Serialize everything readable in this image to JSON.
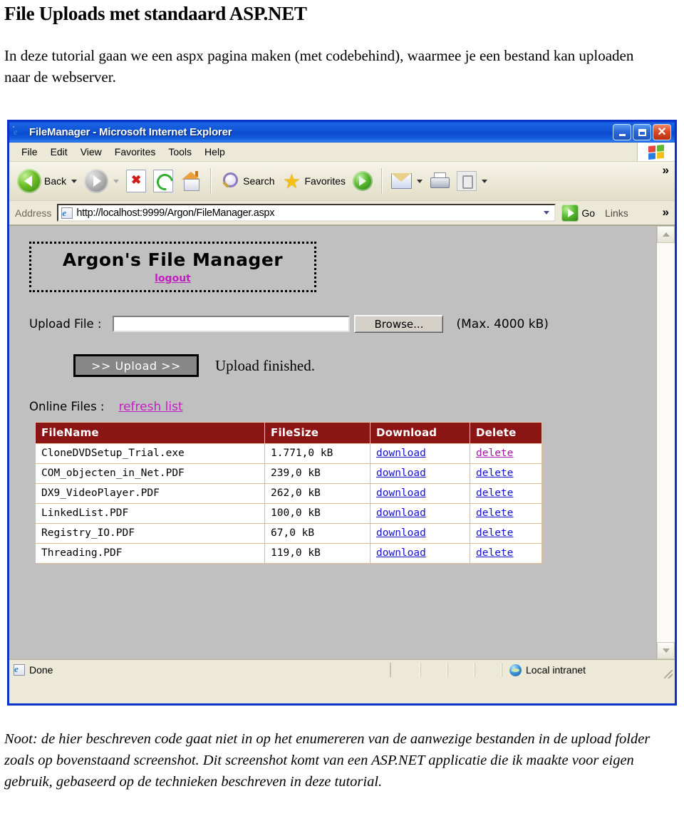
{
  "document": {
    "title": "File Uploads met standaard ASP.NET",
    "intro": "In deze tutorial gaan we een aspx pagina maken (met codebehind), waarmee je een bestand kan uploaden naar de webserver.",
    "note": "Noot: de hier beschreven code gaat niet in op het enumereren van de aanwezige bestanden in de upload folder zoals op bovenstaand screenshot. Dit screenshot komt van een ASP.NET applicatie die ik maakte voor eigen gebruik, gebaseerd op de technieken beschreven in deze tutorial."
  },
  "browser": {
    "title": "FileManager - Microsoft Internet Explorer",
    "window_buttons": {
      "minimize": "minimize",
      "maximize": "restore",
      "close": "close"
    },
    "menu": [
      "File",
      "Edit",
      "View",
      "Favorites",
      "Tools",
      "Help"
    ],
    "menu_overflow": "»",
    "toolbar": {
      "back": "Back",
      "forward": "",
      "stop": "",
      "refresh": "",
      "home": "",
      "search": "Search",
      "favorites": "Favorites",
      "media": "",
      "mail": "",
      "print": "",
      "edit": "",
      "overflow": "»"
    },
    "address": {
      "label": "Address",
      "url": "http://localhost:9999/Argon/FileManager.aspx",
      "go_label": "Go",
      "links_label": "Links",
      "overflow": "»"
    },
    "status": {
      "text": "Done",
      "zone": "Local intranet"
    }
  },
  "app": {
    "title": "Argon's File Manager",
    "logout_label": "logout",
    "upload": {
      "label": "Upload File :",
      "field_value": "",
      "browse_label": "Browse...",
      "max_note": "(Max. 4000 kB)",
      "submit_label": ">> Upload >>",
      "status": "Upload finished."
    },
    "files": {
      "label": "Online Files :",
      "refresh_label": "refresh list",
      "columns": [
        "FileName",
        "FileSize",
        "Download",
        "Delete"
      ],
      "rows": [
        {
          "name": "CloneDVDSetup_Trial.exe",
          "size": "1.771,0 kB",
          "download": "download",
          "delete": "delete",
          "delete_visited": true
        },
        {
          "name": "COM_objecten_in_Net.PDF",
          "size": "239,0 kB",
          "download": "download",
          "delete": "delete",
          "delete_visited": false
        },
        {
          "name": "DX9_VideoPlayer.PDF",
          "size": "262,0 kB",
          "download": "download",
          "delete": "delete",
          "delete_visited": false
        },
        {
          "name": "LinkedList.PDF",
          "size": "100,0 kB",
          "download": "download",
          "delete": "delete",
          "delete_visited": false
        },
        {
          "name": "Registry_IO.PDF",
          "size": "67,0 kB",
          "download": "download",
          "delete": "delete",
          "delete_visited": false
        },
        {
          "name": "Threading.PDF",
          "size": "119,0 kB",
          "download": "download",
          "delete": "delete",
          "delete_visited": false
        }
      ]
    }
  },
  "colors": {
    "titlebar_blue": "#0f55d6",
    "window_border": "#0a31c8",
    "chrome": "#ece9d8",
    "page_background": "#c0c0c0",
    "table_header": "#8b1414",
    "table_border": "#e0b98e",
    "link": "#1414d0",
    "visited_link": "#c020c0",
    "upload_button": "#878787"
  }
}
